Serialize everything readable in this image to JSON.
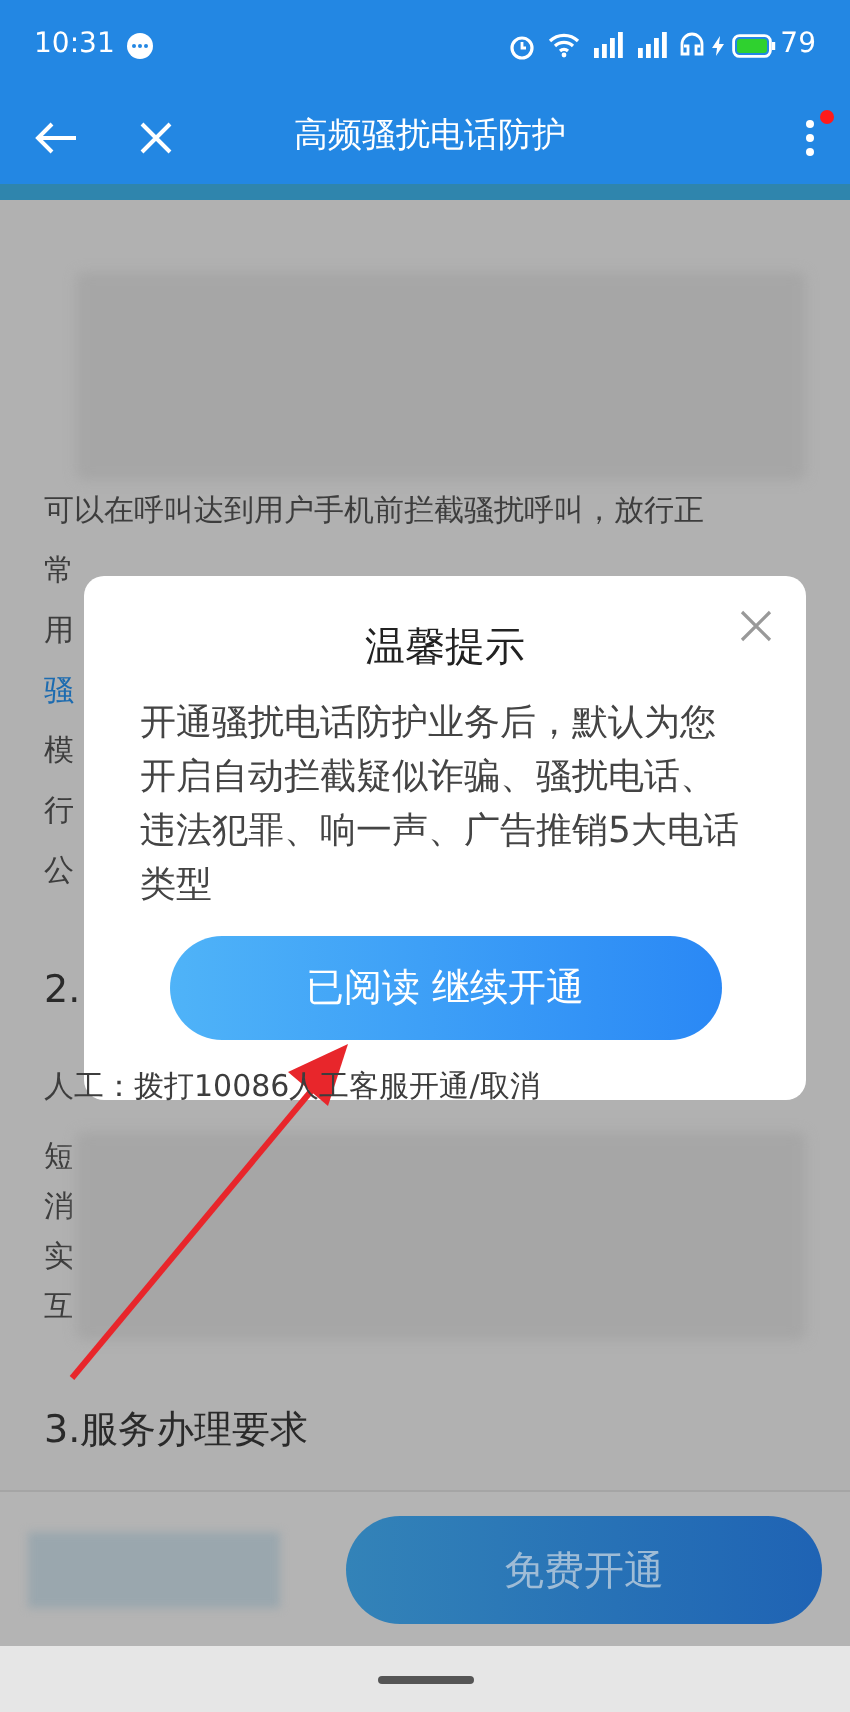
{
  "status_bar": {
    "time": "10:31",
    "battery": "79"
  },
  "app_bar": {
    "title": "高频骚扰电话防护",
    "notification_dot": true
  },
  "content": [
    {
      "kind": "blurred"
    },
    {
      "kind": "text",
      "text": "可以在呼叫达到用户手机前拦截骚扰呼叫，放行正"
    },
    {
      "kind": "text",
      "text": "常"
    },
    {
      "kind": "text",
      "text": "用"
    },
    {
      "kind": "link",
      "text": "骚"
    },
    {
      "kind": "text",
      "text": "模"
    },
    {
      "kind": "text",
      "text": "行"
    },
    {
      "kind": "text",
      "text": "公"
    },
    {
      "kind": "heading",
      "text": "2."
    },
    {
      "kind": "text",
      "text": "人工：拨打10086人工客服开通/取消"
    },
    {
      "kind": "blurred",
      "side_chars": [
        "短",
        "消",
        "实",
        "互"
      ]
    },
    {
      "kind": "heading",
      "text": "3.服务办理要求"
    }
  ],
  "dialog": {
    "title": "温馨提示",
    "message": "开通骚扰电话防护业务后，默认为您开启自动拦截疑似诈骗、骚扰电话、违法犯罪、响一声、广告推销5大电话类型",
    "button": "已阅读 继续开通"
  },
  "bottom_bar": {
    "button": "免费开通"
  }
}
